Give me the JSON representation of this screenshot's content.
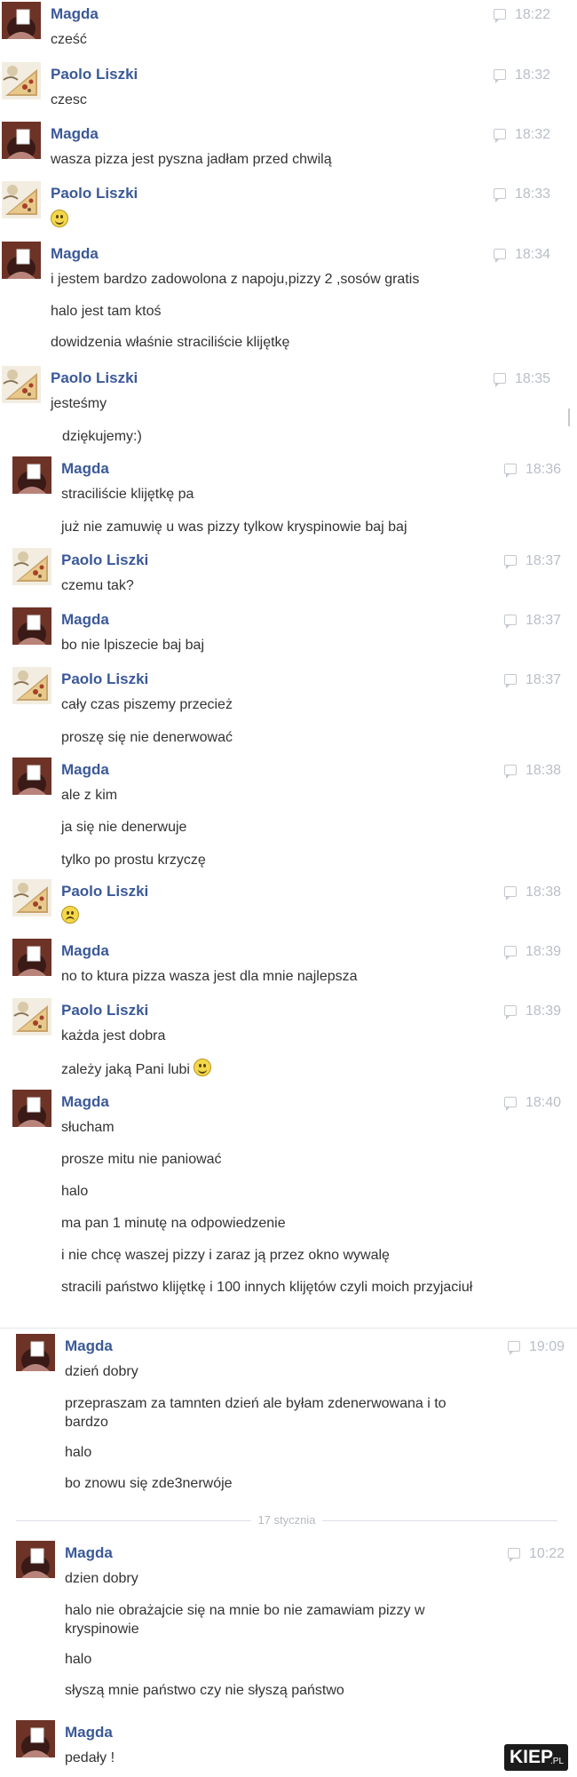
{
  "conversation": {
    "groups": [
      {
        "sender": "Magda",
        "avatar": "magda-avatar-icon",
        "time": "18:22",
        "messages": [
          {
            "text": "cześć"
          }
        ]
      },
      {
        "sender": "Paolo Liszki",
        "avatar": "pizza-avatar-icon",
        "time": "18:32",
        "messages": [
          {
            "text": "czesc"
          }
        ]
      },
      {
        "sender": "Magda",
        "avatar": "magda-avatar-icon",
        "time": "18:32",
        "messages": [
          {
            "text": "wasza pizza jest pyszna jadłam przed chwilą"
          }
        ]
      },
      {
        "sender": "Paolo Liszki",
        "avatar": "pizza-avatar-icon",
        "time": "18:33",
        "messages": [
          {
            "text": "",
            "emoji": "smile-emoji-icon"
          }
        ]
      },
      {
        "sender": "Magda",
        "avatar": "magda-avatar-icon",
        "time": "18:34",
        "messages": [
          {
            "text": "i jestem bardzo zadowolona z napoju,pizzy 2 ,sosów gratis"
          },
          {
            "text": "halo jest tam ktoś"
          },
          {
            "text": "dowidzenia właśnie straciliście klijętkę"
          }
        ]
      },
      {
        "sender": "Paolo Liszki",
        "avatar": "pizza-avatar-icon",
        "time": "18:35",
        "messages": [
          {
            "text": "jesteśmy"
          },
          {
            "text": "dziękujemy:)"
          }
        ]
      },
      {
        "sender": "Magda",
        "avatar": "magda-avatar-icon",
        "time": "18:36",
        "messages": [
          {
            "text": "straciliście klijętkę pa"
          },
          {
            "text": "już nie zamuwię u was pizzy tylkow kryspinowie baj baj"
          }
        ]
      },
      {
        "sender": "Paolo Liszki",
        "avatar": "pizza-avatar-icon",
        "time": "18:37",
        "messages": [
          {
            "text": "czemu tak?"
          }
        ]
      },
      {
        "sender": "Magda",
        "avatar": "magda-avatar-icon",
        "time": "18:37",
        "messages": [
          {
            "text": "bo nie lpiszecie baj baj"
          }
        ]
      },
      {
        "sender": "Paolo Liszki",
        "avatar": "pizza-avatar-icon",
        "time": "18:37",
        "messages": [
          {
            "text": "cały czas piszemy przecież"
          },
          {
            "text": "proszę się nie denerwować"
          }
        ]
      },
      {
        "sender": "Magda",
        "avatar": "magda-avatar-icon",
        "time": "18:38",
        "messages": [
          {
            "text": "ale z kim"
          },
          {
            "text": "ja się nie denerwuje"
          },
          {
            "text": "tylko po prostu krzyczę"
          }
        ]
      },
      {
        "sender": "Paolo Liszki",
        "avatar": "pizza-avatar-icon",
        "time": "18:38",
        "messages": [
          {
            "text": "",
            "emoji": "sad-emoji-icon"
          }
        ]
      },
      {
        "sender": "Magda",
        "avatar": "magda-avatar-icon",
        "time": "18:39",
        "messages": [
          {
            "text": "no to ktura pizza wasza jest dla mnie najlepsza"
          }
        ]
      },
      {
        "sender": "Paolo Liszki",
        "avatar": "pizza-avatar-icon",
        "time": "18:39",
        "messages": [
          {
            "text": "każda jest dobra"
          },
          {
            "text": "zależy jaką Pani lubi",
            "emoji": "smile-emoji-icon"
          }
        ]
      },
      {
        "sender": "Magda",
        "avatar": "magda-avatar-icon",
        "time": "18:40",
        "messages": [
          {
            "text": "słucham"
          },
          {
            "text": "prosze mitu nie paniować"
          },
          {
            "text": "halo"
          },
          {
            "text": "ma pan 1 minutę na odpowiedzenie"
          },
          {
            "text": "i nie chcę waszej pizzy i zaraz ją przez okno wywalę"
          },
          {
            "text": "stracili państwo klijętkę i 100 innych klijętów czyli moich przyjaciuł"
          }
        ]
      },
      {
        "sender": "Magda",
        "avatar": "magda-avatar-icon",
        "time": "19:09",
        "messages": [
          {
            "text": "dzień dobry"
          },
          {
            "text": "przepraszam za tamnten dzień ale byłam zdenerwowana i to bardzo"
          },
          {
            "text": "halo"
          },
          {
            "text": "bo znowu się zde3nerwóje"
          }
        ]
      },
      {
        "sender": "Magda",
        "avatar": "magda-avatar-icon",
        "time": "10:22",
        "messages": [
          {
            "text": "dzien dobry"
          },
          {
            "text": "halo nie obrażajcie się na mnie bo nie zamawiam pizzy w kryspinowie"
          },
          {
            "text": "halo"
          },
          {
            "text": "słyszą mnie państwo czy nie słyszą państwo"
          }
        ]
      },
      {
        "sender": "Magda",
        "avatar": "magda-avatar-icon",
        "time": "",
        "messages": [
          {
            "text": "pedały !"
          }
        ]
      }
    ],
    "date_separator": "17 stycznia"
  },
  "watermark": {
    "main": "KIEP",
    "suffix": ".PL"
  },
  "colors": {
    "sender": "#3b5998",
    "text": "#333333",
    "timestamp": "#b9bec7",
    "background": "#ffffff"
  }
}
